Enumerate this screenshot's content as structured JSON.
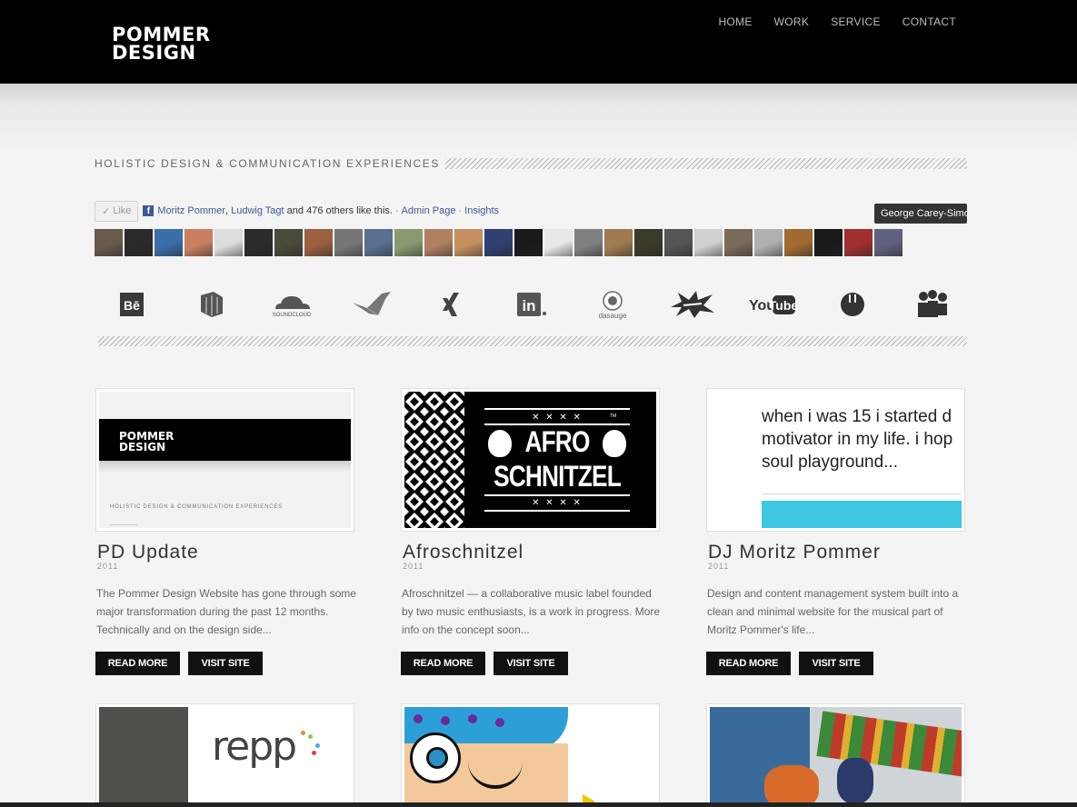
{
  "header": {
    "logo_line1": "POMMER",
    "logo_line2": "DESIGN",
    "nav": [
      "HOME",
      "WORK",
      "SERVICE",
      "CONTACT"
    ]
  },
  "tagline": "HOLISTIC DESIGN & COMMUNICATION EXPERIENCES",
  "facebook": {
    "like_label": "Like",
    "friend1": "Moritz Pommer",
    "friend2": "Ludwig Tagt",
    "others_text": "and 476 others like this.",
    "admin_link": "Admin Page",
    "insights_link": "Insights",
    "tooltip": "George Carey-Simos"
  },
  "avatar_colors": [
    "#6a5a4c",
    "#2a2a2a",
    "#3a6ea8",
    "#c88060",
    "#ddd",
    "#2b2b2b",
    "#4a4a3a",
    "#9a6040",
    "#777",
    "#5a7090",
    "#8a9a70",
    "#b08060",
    "#c49060",
    "#304070",
    "#1a1a1a",
    "#e8e8e8",
    "#808080",
    "#a07a50",
    "#3a3a2a",
    "#555",
    "#d0d0d0",
    "#7a6a5a",
    "#b0b0b0",
    "#a06a30",
    "#1a1a1a",
    "#a03030",
    "#606080",
    "#f0d0a0",
    "#c02020",
    "#2a3a6a",
    "#b03030",
    "#6a8aaa"
  ],
  "social": [
    "behance-icon",
    "forrst-icon",
    "soundcloud-icon",
    "bird-icon",
    "xing-icon",
    "linkedin-icon",
    "dasauge-icon",
    "splash-icon",
    "youtube-icon",
    "circle-icon",
    "myspace-icon"
  ],
  "social_text": {
    "behance": "Bē",
    "soundcloud": "SOUNDCLOUD",
    "xing": "✕",
    "linkedin": "in",
    "dasauge": "dasauge",
    "youtube_you": "You",
    "youtube_tube": "Tube"
  },
  "cards": [
    {
      "title": "PD Update",
      "year": "2011",
      "desc": "The Pommer Design Website has gone through some major transformation during the past 12 months. Technically and on the design side...",
      "read": "READ MORE",
      "visit": "VISIT SITE",
      "thumb_logo1": "POMMER",
      "thumb_logo2": "DESIGN",
      "thumb_tagline": "HOLISTIC DESIGN & COMMUNICATION EXPERIENCES"
    },
    {
      "title": "Afroschnitzel",
      "year": "2011",
      "desc": "Afroschnitzel — a collaborative music label founded by two music enthusiasts, is a work in progress. More info on the concept soon...",
      "read": "READ MORE",
      "visit": "VISIT SITE",
      "thumb_line1": "AFRO",
      "thumb_line2": "SCHNITZEL",
      "thumb_x": "✕ ✕ ✕ ✕",
      "thumb_tm": "TM"
    },
    {
      "title": "DJ Moritz Pommer",
      "year": "2011",
      "desc": "Design and content management system built into a clean and minimal website for the musical part of Moritz Pommer's life...",
      "read": "READ MORE",
      "visit": "VISIT SITE",
      "thumb_text": "when i was 15 i started d motivator in my life. i hop soul playground..."
    }
  ],
  "row2": {
    "repp_text": "repp"
  }
}
